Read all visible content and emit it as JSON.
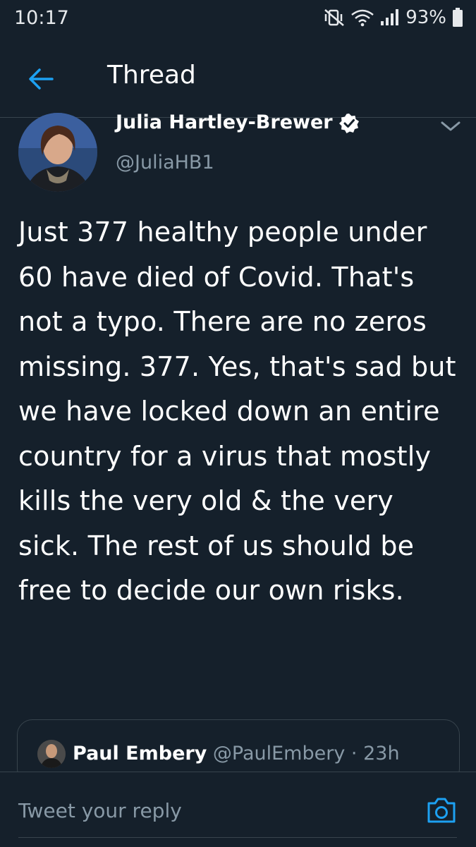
{
  "status_bar": {
    "time": "10:17",
    "battery": "93%",
    "icons": [
      "vibrate-mute-icon",
      "wifi-icon",
      "signal-icon",
      "battery-icon"
    ]
  },
  "header": {
    "title": "Thread",
    "back_icon": "arrow-left-icon"
  },
  "tweet": {
    "author_name": "Julia Hartley-Brewer",
    "handle": "@JuliaHB1",
    "verified": true,
    "text": "Just 377 healthy people under 60 have died of Covid. That's not a typo. There are no zeros missing. 377. Yes, that's sad but we have locked down an entire country for a virus that mostly kills the very old & the very sick. The rest of us should be free to decide our own risks."
  },
  "quote": {
    "name": "Paul Embery",
    "handle": "@PaulEmbery",
    "separator": "·",
    "time": "23h"
  },
  "reply": {
    "placeholder": "Tweet your reply",
    "camera_icon": "camera-icon"
  },
  "colors": {
    "background": "#15202b",
    "accent": "#1da1f2",
    "muted": "#8899a6",
    "border": "#38444d"
  }
}
